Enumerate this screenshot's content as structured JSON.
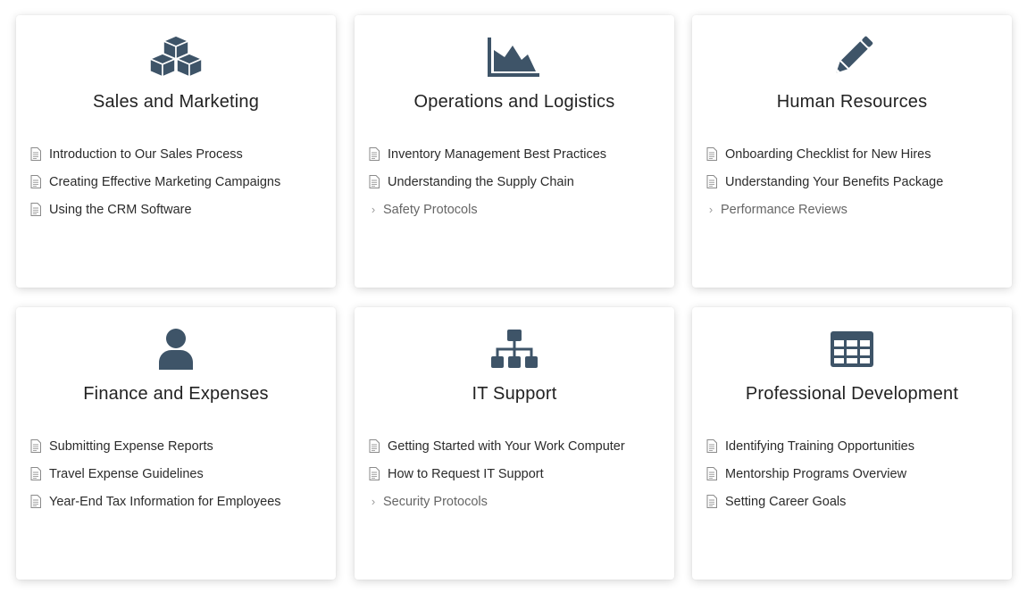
{
  "icon_color": "#3e5468",
  "cards": [
    {
      "icon": "cubes-icon",
      "title": "Sales and Marketing",
      "items": [
        {
          "label": "Introduction to Our Sales Process",
          "type": "document"
        },
        {
          "label": "Creating Effective Marketing Campaigns",
          "type": "document"
        },
        {
          "label": "Using the CRM Software",
          "type": "document"
        }
      ]
    },
    {
      "icon": "area-chart-icon",
      "title": "Operations and Logistics",
      "items": [
        {
          "label": "Inventory Management Best Practices",
          "type": "document"
        },
        {
          "label": "Understanding the Supply Chain",
          "type": "document"
        },
        {
          "label": "Safety Protocols",
          "type": "category"
        }
      ]
    },
    {
      "icon": "pencil-icon",
      "title": "Human Resources",
      "items": [
        {
          "label": "Onboarding Checklist for New Hires",
          "type": "document"
        },
        {
          "label": "Understanding Your Benefits Package",
          "type": "document"
        },
        {
          "label": "Performance Reviews",
          "type": "category"
        }
      ]
    },
    {
      "icon": "user-icon",
      "title": "Finance and Expenses",
      "items": [
        {
          "label": "Submitting Expense Reports",
          "type": "document"
        },
        {
          "label": "Travel Expense Guidelines",
          "type": "document"
        },
        {
          "label": "Year-End Tax Information for Employees",
          "type": "document"
        }
      ]
    },
    {
      "icon": "sitemap-icon",
      "title": "IT Support",
      "items": [
        {
          "label": "Getting Started with Your Work Computer",
          "type": "document"
        },
        {
          "label": "How to Request IT Support",
          "type": "document"
        },
        {
          "label": "Security Protocols",
          "type": "category"
        }
      ]
    },
    {
      "icon": "table-icon",
      "title": "Professional Development",
      "items": [
        {
          "label": "Identifying Training Opportunities",
          "type": "document"
        },
        {
          "label": "Mentorship Programs Overview",
          "type": "document"
        },
        {
          "label": "Setting Career Goals",
          "type": "document"
        }
      ]
    }
  ]
}
